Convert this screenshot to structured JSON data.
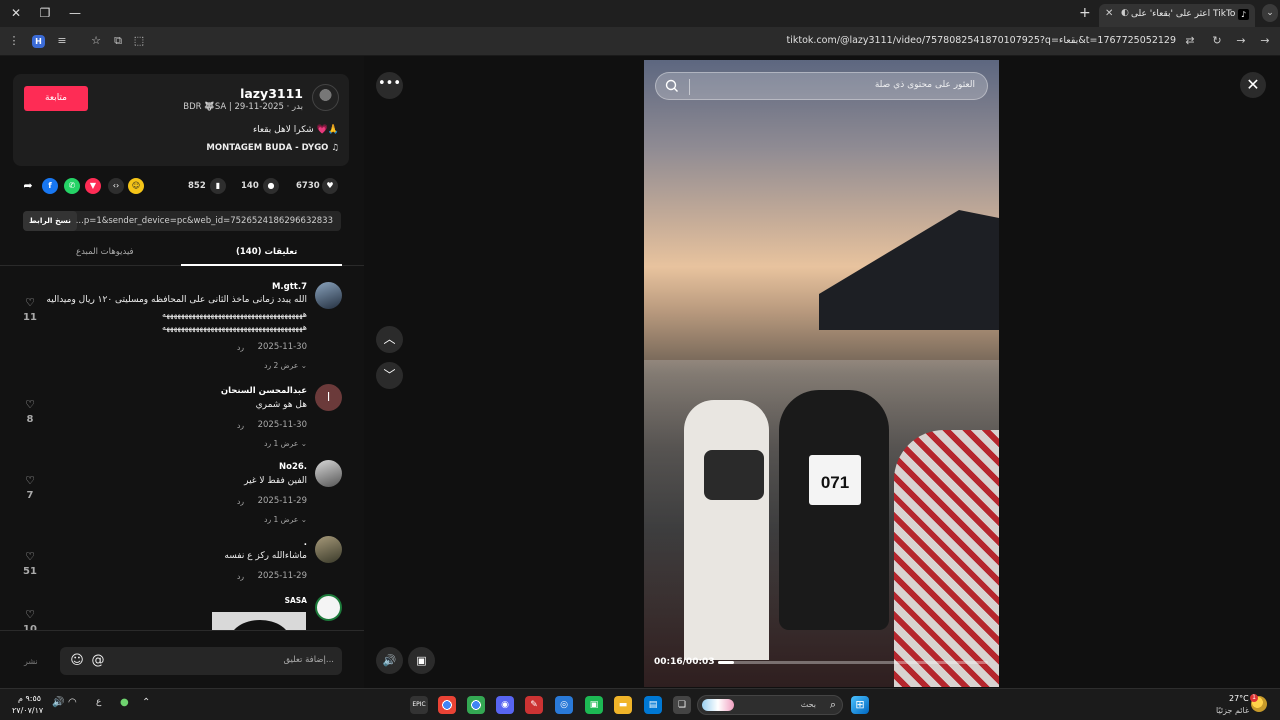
{
  "browser": {
    "tab_title": "اعثر على 'بقعاء' على TikTok",
    "tab_favicon": "♪",
    "url": "tiktok.com/@lazy3111/video/7578082541870107925?q=بقعاء&t=1767725052129",
    "profile_letter": "H"
  },
  "author": {
    "follow_label": "متابعة",
    "username": "lazy3111",
    "subline": "BDR 🐺SA | بدر · 2025-11-29",
    "caption": "شكرا لاهل بقعاء 💗🙏",
    "music_note": "♫",
    "music": "MONTAGEM BUDA - DYGO"
  },
  "stats": {
    "likes": "6730",
    "comments": "140",
    "saves": "852"
  },
  "link": {
    "copy_label": "نسخ الرابط",
    "text": "...p=1&sender_device=pc&web_id=7526524186296632833"
  },
  "tabs": {
    "comments": "تعليقات (140)",
    "creator_videos": "فيديوهات المبدع"
  },
  "comments": [
    {
      "name": "M.gtt.7",
      "lines": [
        "الله يبدد زمانى ماخذ الثانى على المحافظه ومسليتى ١٢٠ ريال وميداليه",
        "ههههههههههههههههههههههههههههههههههههههه",
        "ههههههههههههههههههههههههههههههههههههههه"
      ],
      "date": "2025-11-30",
      "reply": "رد",
      "view_replies": "عرض 2 رد ⌄",
      "likes": "11"
    },
    {
      "name": "عبدالمحسن السنحان",
      "avatar_letter": "ا",
      "lines": [
        "هل هو شمري"
      ],
      "date": "2025-11-30",
      "reply": "رد",
      "view_replies": "عرض 1 رد ⌄",
      "likes": "8"
    },
    {
      "name": "No26.",
      "lines": [
        "الفين فقط لا غير"
      ],
      "date": "2025-11-29",
      "reply": "رد",
      "view_replies": "عرض 1 رد ⌄",
      "likes": "7"
    },
    {
      "name": ".",
      "lines": [
        "ماشاءالله ركز ع نفسه"
      ],
      "date": "2025-11-29",
      "reply": "رد",
      "likes": "51"
    },
    {
      "name": "SASA",
      "likes": "10"
    }
  ],
  "comment_box": {
    "post_label": "نشر",
    "placeholder": "إضافة تعليق..."
  },
  "video": {
    "search_placeholder": "العثور على محتوى ذي صلة",
    "time": "00:16/00:03",
    "progress": 0.06,
    "bib_number": "071"
  },
  "taskbar": {
    "search_placeholder": "بحث",
    "temp": "27°C",
    "weather_desc": "غائم جزئيًا",
    "weather_badge": "1",
    "clock_time": "٩:٥٥ م",
    "clock_date": "٢٧/٠٧/١٧",
    "lang": "ع"
  }
}
